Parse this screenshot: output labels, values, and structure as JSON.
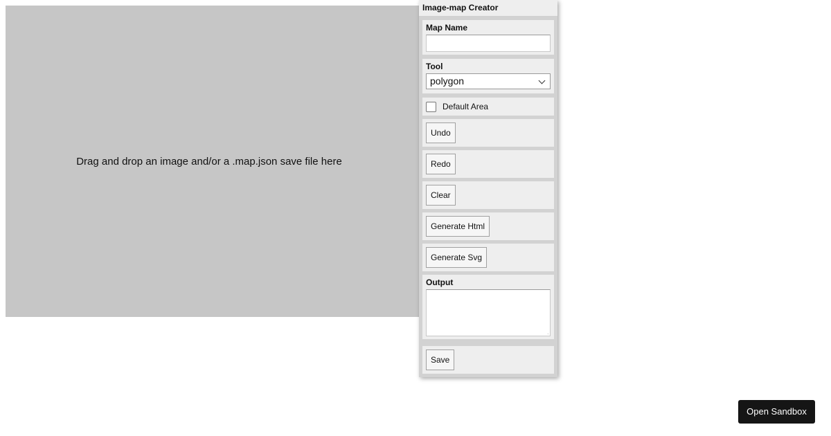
{
  "dropzone": {
    "message": "Drag and drop an image and/or a .map.json save file here"
  },
  "panel": {
    "title": "Image-map Creator",
    "map_name": {
      "label": "Map Name",
      "value": ""
    },
    "tool": {
      "label": "Tool",
      "selected": "polygon"
    },
    "default_area": {
      "label": "Default Area",
      "checked": false
    },
    "buttons": {
      "undo": "Undo",
      "redo": "Redo",
      "clear": "Clear",
      "generate_html": "Generate Html",
      "generate_svg": "Generate Svg",
      "save": "Save"
    },
    "output": {
      "label": "Output",
      "value": ""
    }
  },
  "sandbox_button": "Open Sandbox",
  "icons": {
    "tool_select": "chevron-down-icon",
    "output_resize": "resize-grip-icon"
  },
  "colors": {
    "dropzone_bg": "#c6c6c6",
    "panel_section_bg": "#eeeeee",
    "sandbox_button_bg": "#151515"
  }
}
